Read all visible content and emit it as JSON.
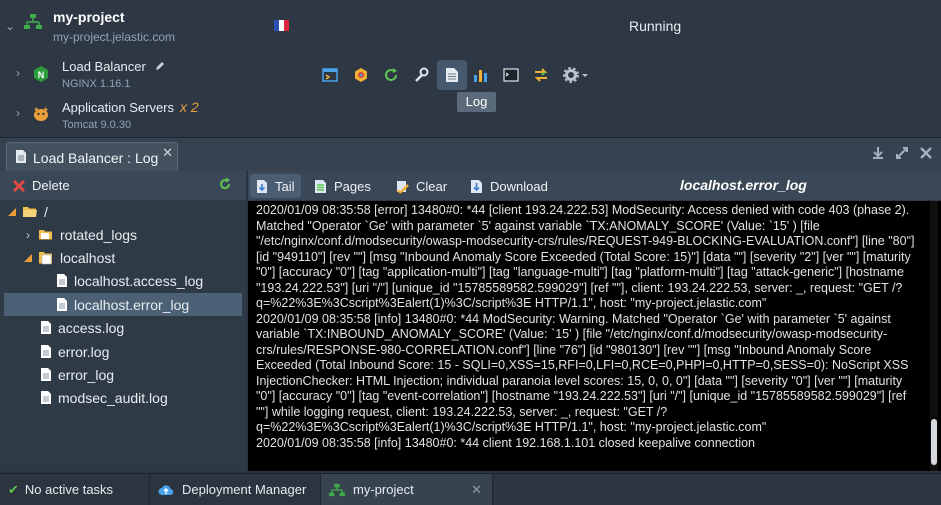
{
  "environment": {
    "name": "my-project",
    "url": "my-project.jelastic.com",
    "status": "Running",
    "region_flag": [
      "#2a4fb6",
      "#ffffff",
      "#d7263d"
    ],
    "nodes": [
      {
        "name": "Load Balancer",
        "version": "NGINX 1.16.1",
        "icon": "nginx-icon"
      },
      {
        "name": "Application Servers",
        "version": "Tomcat 9.0.30",
        "scale": "x 2",
        "icon": "tomcat-icon"
      }
    ]
  },
  "node_tools": {
    "items": [
      "web-ssh",
      "add-ons",
      "restart",
      "config",
      "log",
      "statistics",
      "terminal",
      "redeploy",
      "settings"
    ],
    "tooltip": "Log"
  },
  "tab": {
    "label": "Load Balancer : Log"
  },
  "tree": {
    "delete_label": "Delete",
    "items": [
      {
        "label": "/",
        "type": "root-folder"
      },
      {
        "label": "rotated_logs",
        "type": "folder"
      },
      {
        "label": "localhost",
        "type": "folder-open"
      },
      {
        "label": "localhost.access_log",
        "type": "file"
      },
      {
        "label": "localhost.error_log",
        "type": "file",
        "selected": true
      },
      {
        "label": "access.log",
        "type": "file"
      },
      {
        "label": "error.log",
        "type": "file"
      },
      {
        "label": "error_log",
        "type": "file"
      },
      {
        "label": "modsec_audit.log",
        "type": "file"
      }
    ]
  },
  "log_toolbar": {
    "tail": "Tail",
    "pages": "Pages",
    "clear": "Clear",
    "download": "Download",
    "filename": "localhost.error_log"
  },
  "log_lines": [
    "2020/01/09 08:35:58 [error] 13480#0: *44 [client 193.24.222.53] ModSecurity: Access denied with code 403 (phase 2). Matched \"Operator `Ge' with parameter `5' against variable `TX:ANOMALY_SCORE' (Value: `15' ) [file \"/etc/nginx/conf.d/modsecurity/owasp-modsecurity-crs/rules/REQUEST-949-BLOCKING-EVALUATION.conf\"] [line \"80\"] [id \"949110\"] [rev \"\"] [msg \"Inbound Anomaly Score Exceeded (Total Score: 15)\"] [data \"\"] [severity \"2\"] [ver \"\"] [maturity \"0\"] [accuracy \"0\"] [tag \"application-multi\"] [tag \"language-multi\"] [tag \"platform-multi\"] [tag \"attack-generic\"] [hostname \"193.24.222.53\"] [uri \"/\"] [unique_id \"15785589582.599029\"] [ref \"\"], client: 193.24.222.53, server: _, request: \"GET /?q=%22%3E%3Cscript%3Ealert(1)%3C/script%3E HTTP/1.1\", host: \"my-project.jelastic.com\"",
    "2020/01/09 08:35:58 [info] 13480#0: *44 ModSecurity: Warning. Matched \"Operator `Ge' with parameter `5' against variable `TX:INBOUND_ANOMALY_SCORE' (Value: `15' ) [file \"/etc/nginx/conf.d/modsecurity/owasp-modsecurity-crs/rules/RESPONSE-980-CORRELATION.conf\"] [line \"76\"] [id \"980130\"] [rev \"\"] [msg \"Inbound Anomaly Score Exceeded (Total Inbound Score: 15 - SQLI=0,XSS=15,RFI=0,LFI=0,RCE=0,PHPI=0,HTTP=0,SESS=0): NoScript XSS InjectionChecker: HTML Injection; individual paranoia level scores: 15, 0, 0, 0\"] [data \"\"] [severity \"0\"] [ver \"\"] [maturity \"0\"] [accuracy \"0\"] [tag \"event-correlation\"] [hostname \"193.24.222.53\"] [uri \"/\"] [unique_id \"15785589582.599029\"] [ref \"\"] while logging request, client: 193.24.222.53, server: _, request: \"GET /?q=%22%3E%3Cscript%3Ealert(1)%3C/script%3E HTTP/1.1\", host: \"my-project.jelastic.com\"",
    "2020/01/09 08:35:58 [info] 13480#0: *44 client 192.168.1.101 closed keepalive connection"
  ],
  "statusbar": {
    "tasks": "No active tasks",
    "deployment": "Deployment Manager",
    "env_tab": "my-project"
  },
  "colors": {
    "accent_green": "#3fae49",
    "tomcat_orange": "#e89f3a",
    "close_red": "#e04a3f"
  }
}
